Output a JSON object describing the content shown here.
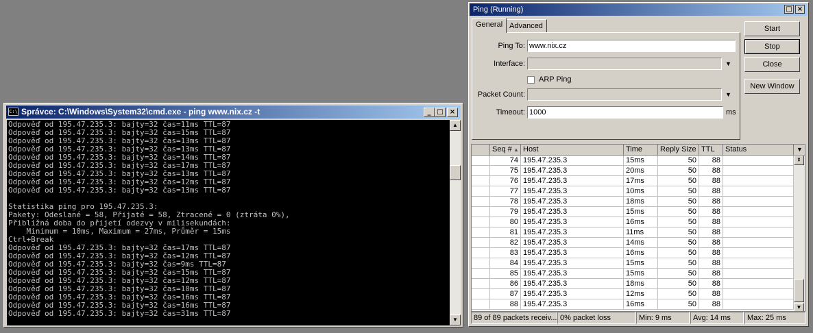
{
  "cmd": {
    "title": "Správce: C:\\Windows\\System32\\cmd.exe - ping  www.nix.cz -t",
    "icon_text": "C:\\",
    "lines": [
      "Odpověď od 195.47.235.3: bajty=32 čas=11ms TTL=87",
      "Odpověď od 195.47.235.3: bajty=32 čas=15ms TTL=87",
      "Odpověď od 195.47.235.3: bajty=32 čas=13ms TTL=87",
      "Odpověď od 195.47.235.3: bajty=32 čas=13ms TTL=87",
      "Odpověď od 195.47.235.3: bajty=32 čas=14ms TTL=87",
      "Odpověď od 195.47.235.3: bajty=32 čas=17ms TTL=87",
      "Odpověď od 195.47.235.3: bajty=32 čas=13ms TTL=87",
      "Odpověď od 195.47.235.3: bajty=32 čas=12ms TTL=87",
      "Odpověď od 195.47.235.3: bajty=32 čas=13ms TTL=87",
      "",
      "Statistika ping pro 195.47.235.3:",
      "Pakety: Odeslané = 58, Přijaté = 58, Ztracené = 0 (ztráta 0%),",
      "Přibližná doba do přijetí odezvy v milisekundách:",
      "    Minimum = 10ms, Maximum = 27ms, Průměr = 15ms",
      "Ctrl+Break",
      "Odpověď od 195.47.235.3: bajty=32 čas=17ms TTL=87",
      "Odpověď od 195.47.235.3: bajty=32 čas=12ms TTL=87",
      "Odpověď od 195.47.235.3: bajty=32 čas=9ms TTL=87",
      "Odpověď od 195.47.235.3: bajty=32 čas=15ms TTL=87",
      "Odpověď od 195.47.235.3: bajty=32 čas=12ms TTL=87",
      "Odpověď od 195.47.235.3: bajty=32 čas=10ms TTL=87",
      "Odpověď od 195.47.235.3: bajty=32 čas=16ms TTL=87",
      "Odpověď od 195.47.235.3: bajty=32 čas=16ms TTL=87",
      "Odpověď od 195.47.235.3: bajty=32 čas=31ms TTL=87"
    ],
    "minimize": "_",
    "maximize": "□",
    "close": "×"
  },
  "ping": {
    "title": "Ping (Running)",
    "maximize": "□",
    "close": "×",
    "tabs": [
      "General",
      "Advanced"
    ],
    "ping_to_label": "Ping To:",
    "ping_to_value": "www.nix.cz",
    "interface_label": "Interface:",
    "interface_value": "",
    "arp_ping_label": "ARP Ping",
    "packet_count_label": "Packet Count:",
    "packet_count_value": "",
    "timeout_label": "Timeout:",
    "timeout_value": "1000",
    "timeout_unit": "ms",
    "dropdown_glyph": "▼",
    "buttons": {
      "start": "Start",
      "stop": "Stop",
      "close": "Close",
      "new_window": "New Window"
    },
    "columns": [
      "Seq #",
      "Host",
      "Time",
      "Reply Size",
      "TTL",
      "Status"
    ],
    "rows": [
      {
        "seq": "74",
        "host": "195.47.235.3",
        "time": "15ms",
        "size": "50",
        "ttl": "88",
        "status": ""
      },
      {
        "seq": "75",
        "host": "195.47.235.3",
        "time": "20ms",
        "size": "50",
        "ttl": "88",
        "status": ""
      },
      {
        "seq": "76",
        "host": "195.47.235.3",
        "time": "17ms",
        "size": "50",
        "ttl": "88",
        "status": ""
      },
      {
        "seq": "77",
        "host": "195.47.235.3",
        "time": "10ms",
        "size": "50",
        "ttl": "88",
        "status": ""
      },
      {
        "seq": "78",
        "host": "195.47.235.3",
        "time": "18ms",
        "size": "50",
        "ttl": "88",
        "status": ""
      },
      {
        "seq": "79",
        "host": "195.47.235.3",
        "time": "15ms",
        "size": "50",
        "ttl": "88",
        "status": ""
      },
      {
        "seq": "80",
        "host": "195.47.235.3",
        "time": "16ms",
        "size": "50",
        "ttl": "88",
        "status": ""
      },
      {
        "seq": "81",
        "host": "195.47.235.3",
        "time": "11ms",
        "size": "50",
        "ttl": "88",
        "status": ""
      },
      {
        "seq": "82",
        "host": "195.47.235.3",
        "time": "14ms",
        "size": "50",
        "ttl": "88",
        "status": ""
      },
      {
        "seq": "83",
        "host": "195.47.235.3",
        "time": "16ms",
        "size": "50",
        "ttl": "88",
        "status": ""
      },
      {
        "seq": "84",
        "host": "195.47.235.3",
        "time": "15ms",
        "size": "50",
        "ttl": "88",
        "status": ""
      },
      {
        "seq": "85",
        "host": "195.47.235.3",
        "time": "15ms",
        "size": "50",
        "ttl": "88",
        "status": ""
      },
      {
        "seq": "86",
        "host": "195.47.235.3",
        "time": "18ms",
        "size": "50",
        "ttl": "88",
        "status": ""
      },
      {
        "seq": "87",
        "host": "195.47.235.3",
        "time": "12ms",
        "size": "50",
        "ttl": "88",
        "status": ""
      },
      {
        "seq": "88",
        "host": "195.47.235.3",
        "time": "16ms",
        "size": "50",
        "ttl": "88",
        "status": ""
      }
    ],
    "status": {
      "packets": "89 of 89 packets receiv...",
      "loss": "0% packet loss",
      "min": "Min: 9 ms",
      "avg": "Avg: 14 ms",
      "max": "Max: 25 ms"
    }
  }
}
